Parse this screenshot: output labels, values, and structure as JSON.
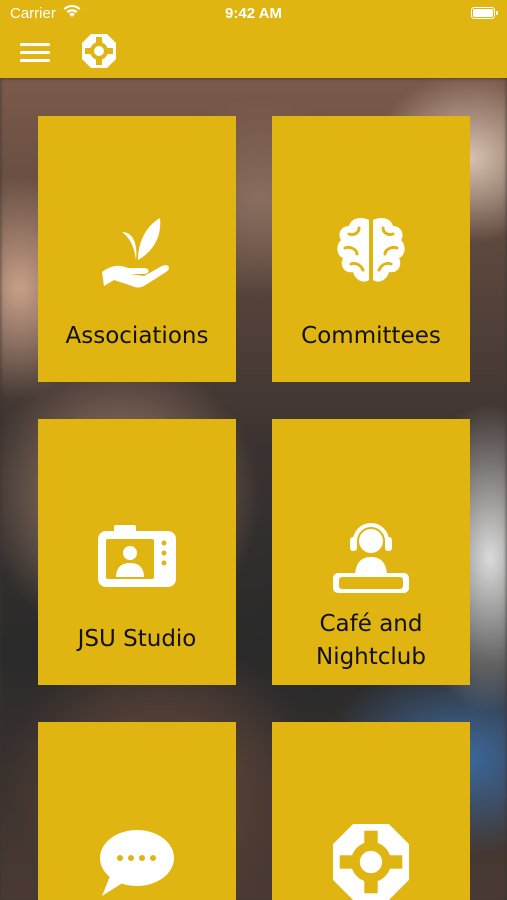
{
  "status_bar": {
    "carrier": "Carrier",
    "time": "9:42 AM"
  },
  "nav": {
    "menu_icon": "hamburger-menu-icon",
    "logo_icon": "jsu-logo-icon"
  },
  "tiles": [
    {
      "label": "Associations",
      "icon": "seedling-in-hand-icon"
    },
    {
      "label": "Committees",
      "icon": "brain-icon"
    },
    {
      "label": "JSU Studio",
      "icon": "camera-portrait-icon"
    },
    {
      "label_line1": "Café and",
      "label_line2": "Nightclub",
      "icon": "dj-headphones-icon"
    },
    {
      "label": "",
      "icon": "chat-bubble-icon"
    },
    {
      "label": "",
      "icon": "jsu-logo-icon"
    }
  ],
  "colors": {
    "brand_yellow": "#e0b511",
    "icon_white": "#ffffff",
    "label_dark": "#111111"
  }
}
